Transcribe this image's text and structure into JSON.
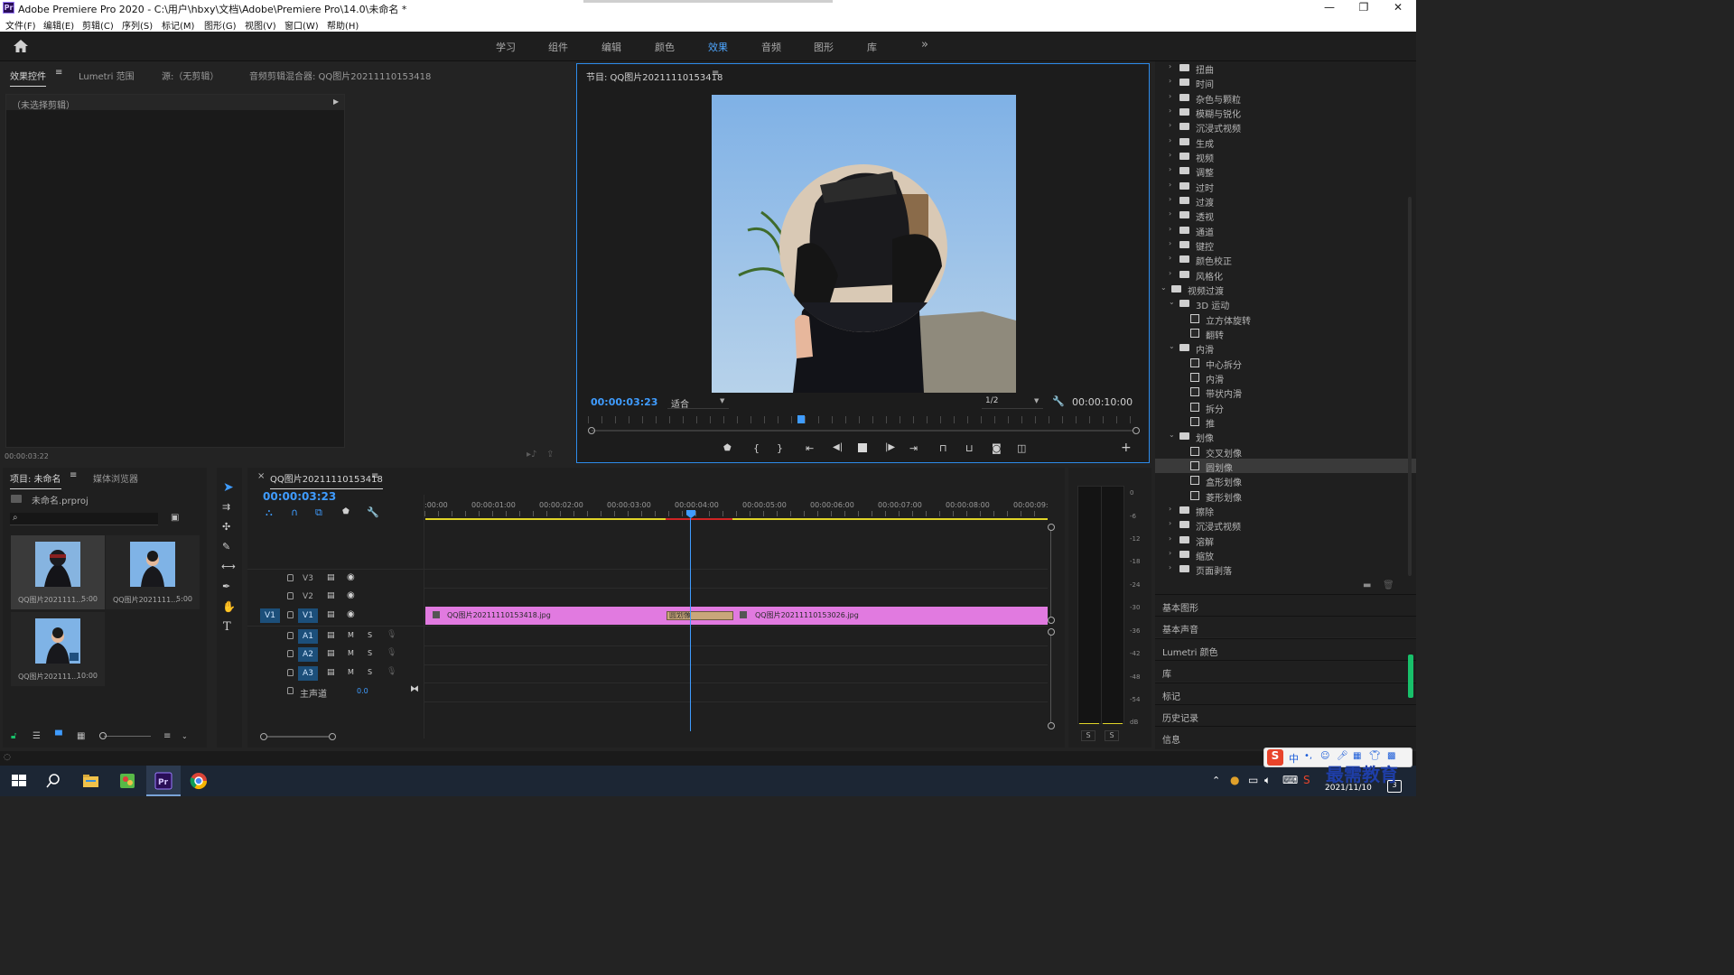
{
  "window": {
    "title": "Adobe Premiere Pro 2020 - C:\\用户\\hbxy\\文档\\Adobe\\Premiere Pro\\14.0\\未命名 *",
    "app_badge": "Pr",
    "minimize": "—",
    "maximize": "❐",
    "close": "✕"
  },
  "menu": [
    "文件(F)",
    "编辑(E)",
    "剪辑(C)",
    "序列(S)",
    "标记(M)",
    "图形(G)",
    "视图(V)",
    "窗口(W)",
    "帮助(H)"
  ],
  "workspaces": {
    "items": [
      "学习",
      "组件",
      "编辑",
      "颜色",
      "效果",
      "音频",
      "图形",
      "库"
    ],
    "active": "效果",
    "more": "»"
  },
  "effect_controls": {
    "tabs": [
      "效果控件",
      "Lumetri 范围",
      "源:（无剪辑）",
      "音频剪辑混合器: QQ图片20211110153418"
    ],
    "no_clip": "（未选择剪辑）",
    "timecode": "00:00:03:22"
  },
  "program": {
    "title": "节目: QQ图片20211110153418",
    "timecode": "00:00:03:23",
    "fit": "适合",
    "quality": "1/2",
    "duration": "00:00:10:00"
  },
  "effects_tree": [
    {
      "label": "扭曲",
      "level": 1,
      "kind": "folder"
    },
    {
      "label": "时间",
      "level": 1,
      "kind": "folder"
    },
    {
      "label": "杂色与颗粒",
      "level": 1,
      "kind": "folder"
    },
    {
      "label": "模糊与锐化",
      "level": 1,
      "kind": "folder"
    },
    {
      "label": "沉浸式视频",
      "level": 1,
      "kind": "folder"
    },
    {
      "label": "生成",
      "level": 1,
      "kind": "folder"
    },
    {
      "label": "视频",
      "level": 1,
      "kind": "folder"
    },
    {
      "label": "调整",
      "level": 1,
      "kind": "folder"
    },
    {
      "label": "过时",
      "level": 1,
      "kind": "folder"
    },
    {
      "label": "过渡",
      "level": 1,
      "kind": "folder"
    },
    {
      "label": "透视",
      "level": 1,
      "kind": "folder"
    },
    {
      "label": "通道",
      "level": 1,
      "kind": "folder"
    },
    {
      "label": "键控",
      "level": 1,
      "kind": "folder"
    },
    {
      "label": "颜色校正",
      "level": 1,
      "kind": "folder"
    },
    {
      "label": "风格化",
      "level": 1,
      "kind": "folder"
    },
    {
      "label": "视频过渡",
      "level": 0,
      "kind": "folder-open"
    },
    {
      "label": "3D 运动",
      "level": 1,
      "kind": "folder-open"
    },
    {
      "label": "立方体旋转",
      "level": 2,
      "kind": "effect"
    },
    {
      "label": "翻转",
      "level": 2,
      "kind": "effect"
    },
    {
      "label": "内滑",
      "level": 1,
      "kind": "folder-open"
    },
    {
      "label": "中心拆分",
      "level": 2,
      "kind": "effect"
    },
    {
      "label": "内滑",
      "level": 2,
      "kind": "effect"
    },
    {
      "label": "带状内滑",
      "level": 2,
      "kind": "effect"
    },
    {
      "label": "拆分",
      "level": 2,
      "kind": "effect"
    },
    {
      "label": "推",
      "level": 2,
      "kind": "effect"
    },
    {
      "label": "划像",
      "level": 1,
      "kind": "folder-open"
    },
    {
      "label": "交叉划像",
      "level": 2,
      "kind": "effect"
    },
    {
      "label": "圆划像",
      "level": 2,
      "kind": "effect",
      "selected": true
    },
    {
      "label": "盒形划像",
      "level": 2,
      "kind": "effect"
    },
    {
      "label": "菱形划像",
      "level": 2,
      "kind": "effect"
    },
    {
      "label": "擦除",
      "level": 1,
      "kind": "folder"
    },
    {
      "label": "沉浸式视频",
      "level": 1,
      "kind": "folder"
    },
    {
      "label": "溶解",
      "level": 1,
      "kind": "folder"
    },
    {
      "label": "缩放",
      "level": 1,
      "kind": "folder"
    },
    {
      "label": "页面剥落",
      "level": 1,
      "kind": "folder"
    }
  ],
  "side_panels": [
    "基本图形",
    "基本声音",
    "Lumetri 颜色",
    "库",
    "标记",
    "历史记录",
    "信息"
  ],
  "project": {
    "tabs": [
      "项目: 未命名",
      "媒体浏览器"
    ],
    "file": "未命名.prproj",
    "items": [
      {
        "name": "QQ图片2021111...",
        "duration": "5:00"
      },
      {
        "name": "QQ图片2021111...",
        "duration": "5:00"
      },
      {
        "name": "QQ图片202111...",
        "duration": "10:00"
      }
    ]
  },
  "timeline": {
    "title": "QQ图片20211110153418",
    "close": "×",
    "timecode": "00:00:03:23",
    "ruler": [
      ":00:00",
      "00:00:01:00",
      "00:00:02:00",
      "00:00:03:00",
      "00:00:04:00",
      "00:00:05:00",
      "00:00:06:00",
      "00:00:07:00",
      "00:00:08:00",
      "00:00:09:"
    ],
    "video_tracks": [
      "V3",
      "V2",
      "V1"
    ],
    "audio_tracks": [
      "A1",
      "A2",
      "A3"
    ],
    "source_patch": "V1",
    "mute": "M",
    "solo": "S",
    "master": "主声道",
    "master_value": "0.0",
    "clip1": "QQ图片20211110153418.jpg",
    "clip2": "QQ图片20211110153026.jpg",
    "transition": "圆划像"
  },
  "audio_meter": {
    "scale": [
      "0",
      "-6",
      "-12",
      "-18",
      "-24",
      "-30",
      "-36",
      "-42",
      "-48",
      "-54",
      "dB"
    ],
    "solo_l": "S",
    "solo_r": "S"
  },
  "taskbar": {
    "date": "2021/11/10",
    "ime": "中",
    "watermark": "最需教育"
  },
  "colors": {
    "accent": "#2d8ceb",
    "clip": "#e17ae0",
    "playhead": "#3f9cff",
    "work_area": "#e0d428"
  }
}
